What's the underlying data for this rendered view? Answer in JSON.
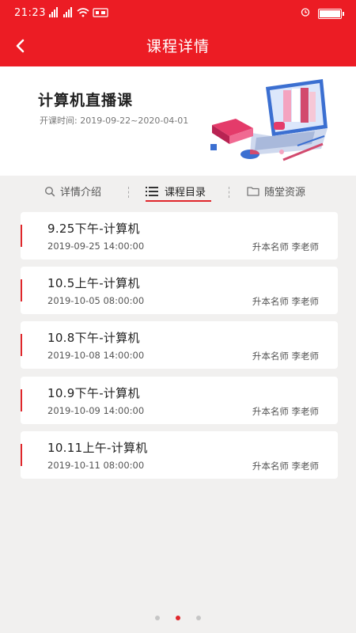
{
  "status_bar": {
    "time": "21:23",
    "signal": "5G 4G",
    "wifi": "Wi-Fi",
    "icons": [
      "alarm-icon",
      "battery-icon"
    ]
  },
  "header": {
    "title": "课程详情",
    "back_icon": "chevron-left-icon"
  },
  "course": {
    "title": "计算机直播课",
    "date_label": "开课时间:",
    "date_range": "2019-09-22~2020-04-01"
  },
  "tabs": [
    {
      "label": "详情介绍",
      "icon": "search-icon",
      "active": false
    },
    {
      "label": "课程目录",
      "icon": "list-icon",
      "active": true
    },
    {
      "label": "随堂资源",
      "icon": "folder-icon",
      "active": false
    }
  ],
  "lessons": [
    {
      "title": "9.25下午-计算机",
      "time": "2019-09-25 14:00:00",
      "teacher": "升本名师 李老师"
    },
    {
      "title": "10.5上午-计算机",
      "time": "2019-10-05 08:00:00",
      "teacher": "升本名师 李老师"
    },
    {
      "title": "10.8下午-计算机",
      "time": "2019-10-08 14:00:00",
      "teacher": "升本名师 李老师"
    },
    {
      "title": "10.9下午-计算机",
      "time": "2019-10-09 14:00:00",
      "teacher": "升本名师 李老师"
    },
    {
      "title": "10.11上午-计算机",
      "time": "2019-10-11 08:00:00",
      "teacher": "升本名师 李老师"
    }
  ],
  "pager": {
    "total": 3,
    "active_index": 1
  },
  "colors": {
    "primary": "#ec1c24",
    "accent": "#e0262b",
    "background": "#f1f0ef"
  }
}
